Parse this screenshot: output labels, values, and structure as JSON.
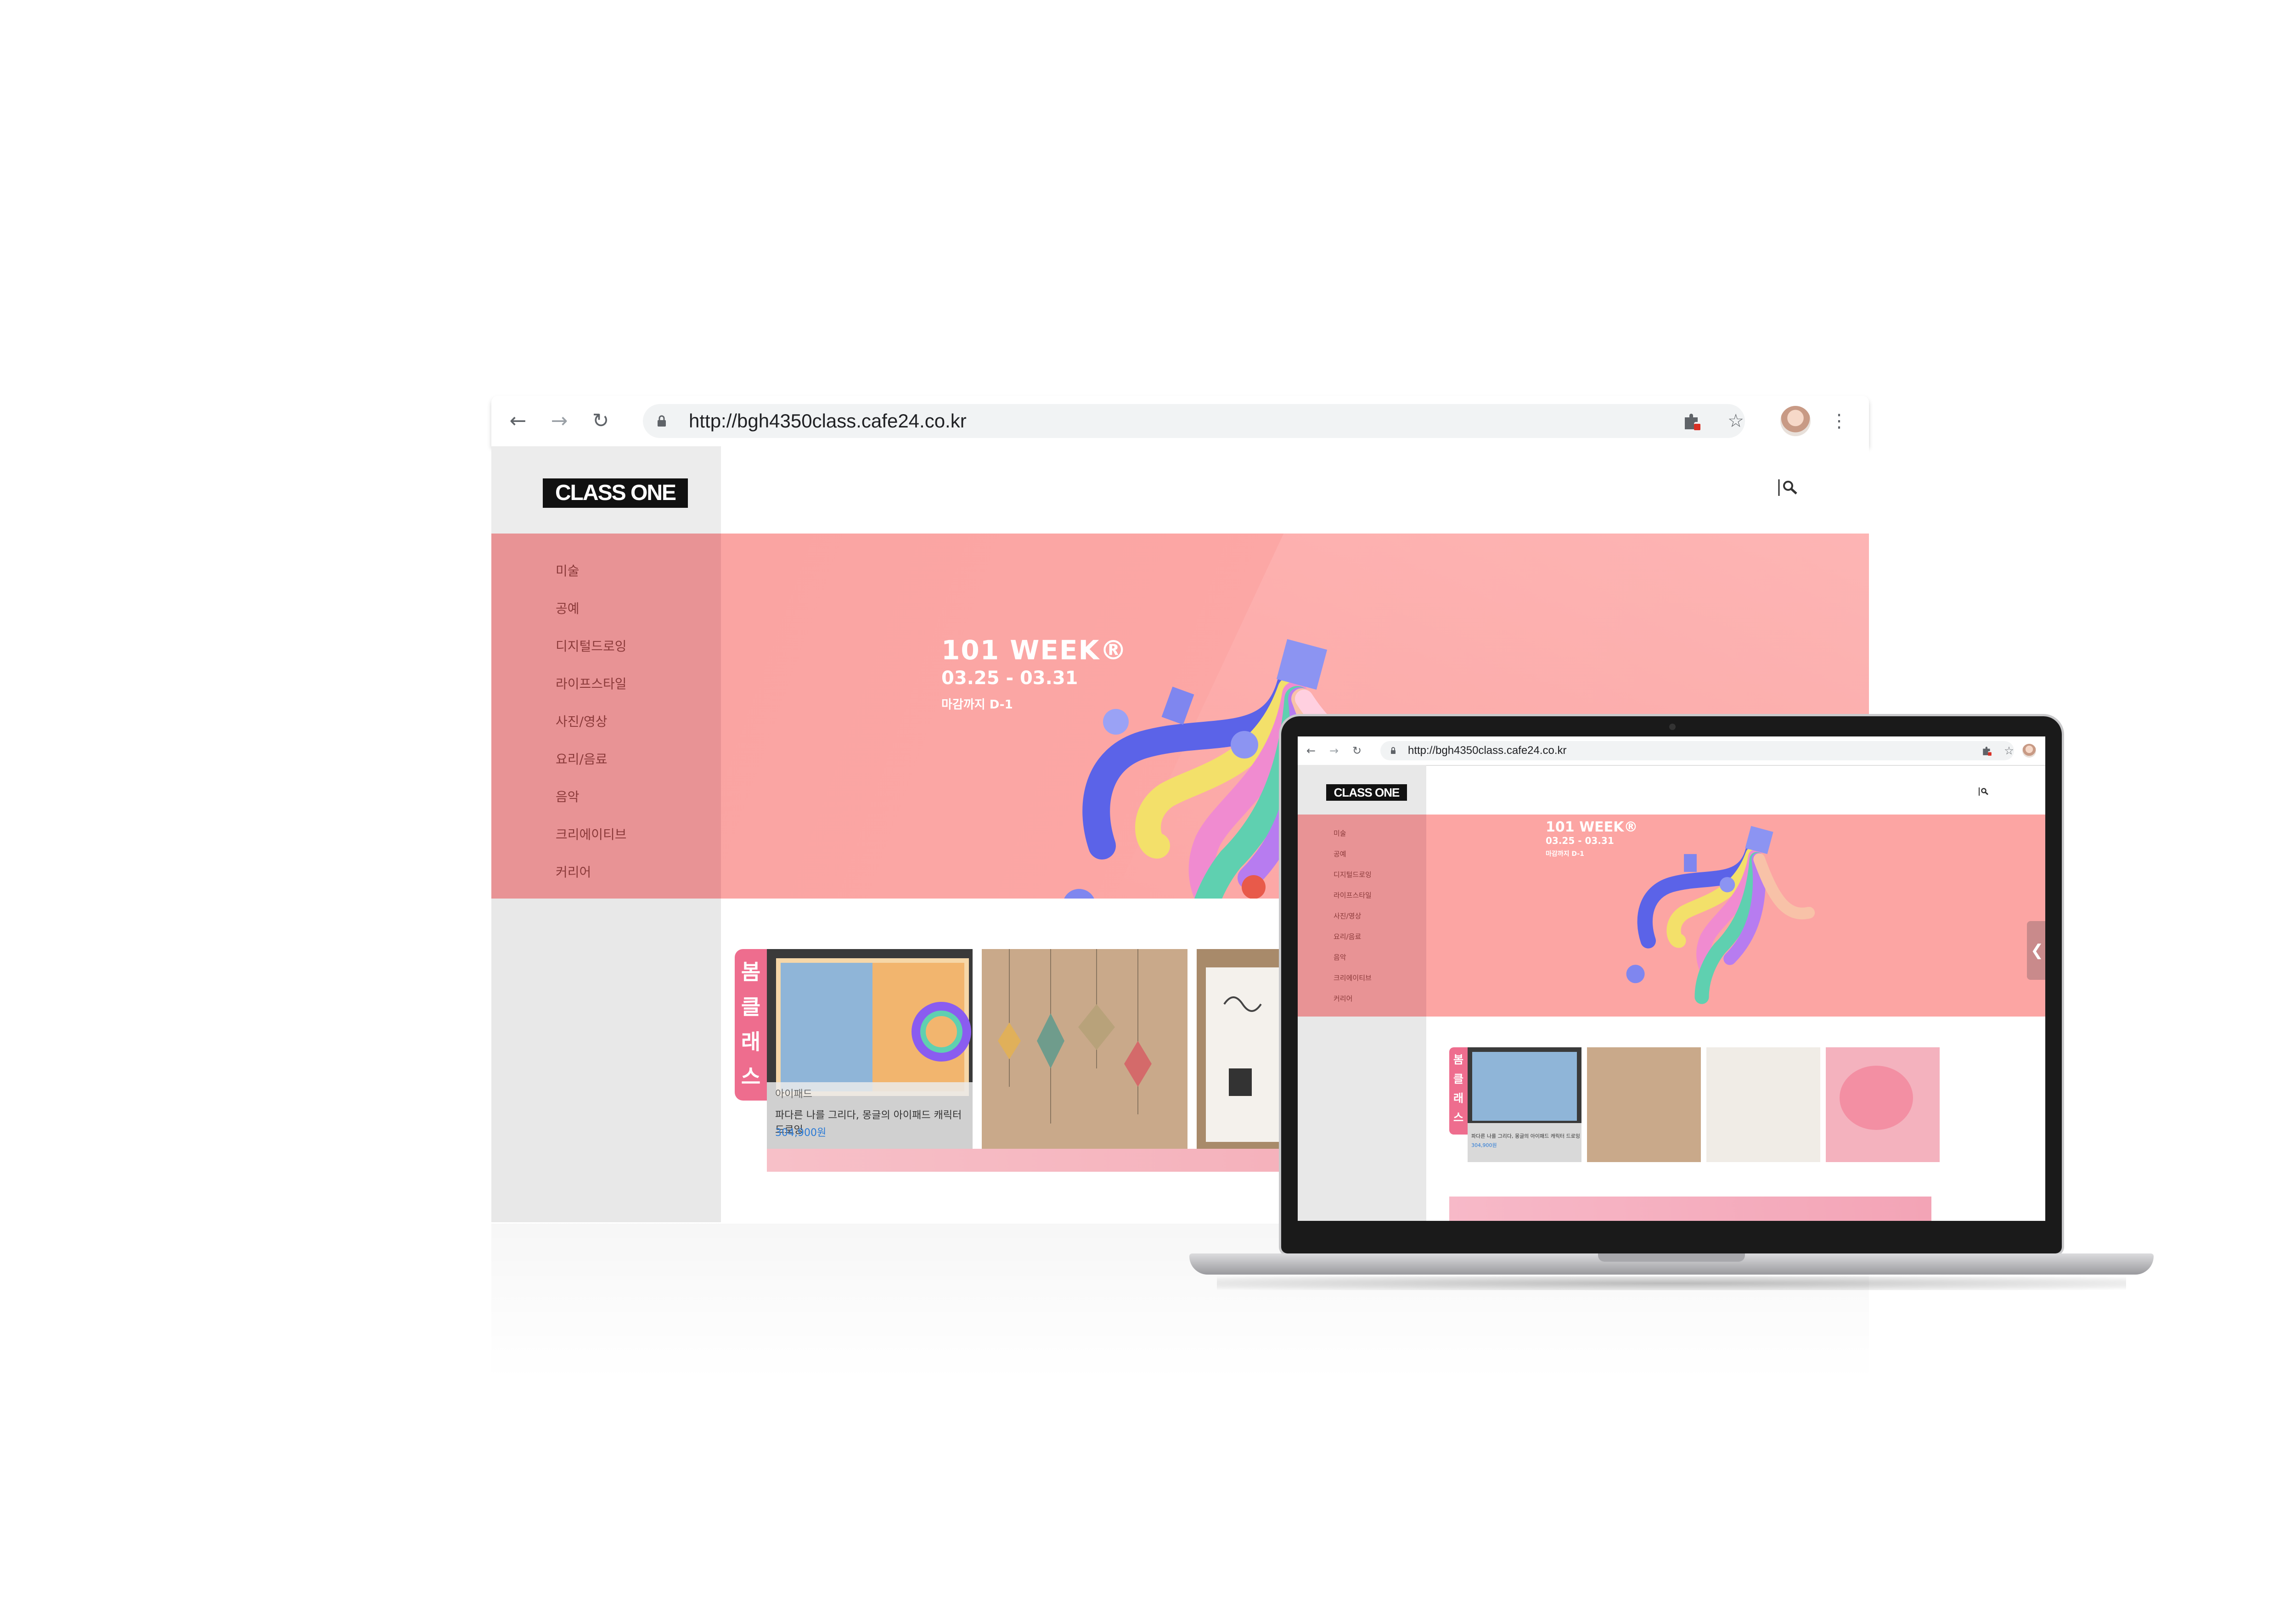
{
  "browser": {
    "url": "http://bgh4350class.cafe24.co.kr",
    "icons": {
      "back": "arrow-left-icon",
      "forward": "arrow-right-icon",
      "reload": "reload-icon",
      "lock": "lock-icon",
      "extension": "puzzle-icon",
      "bookmark": "star-icon",
      "profile": "avatar",
      "menu": "kebab-menu-icon"
    }
  },
  "site": {
    "logo": "CLASS ONE",
    "categories": [
      "미술",
      "공예",
      "디지털드로잉",
      "라이프스타일",
      "사진/영상",
      "요리/음료",
      "음악",
      "크리에이티브",
      "커리어"
    ],
    "hero": {
      "title": "101 WEEK®",
      "dates": "03.25 - 03.31",
      "deadline": "마감까지 D-1"
    },
    "products_badge": "봄클래스",
    "products": [
      {
        "category": "아이패드",
        "title": "파다른 나를 그리다, 몽글의 아이패드 캐릭터 드로잉",
        "price": "304,900원"
      }
    ],
    "colors": {
      "hero_bg": "#fca7a5",
      "category_panel": "#e89395",
      "badge": "#ee6d8e",
      "sidebar": "#e8e8e8",
      "price": "#2a7ad6"
    }
  },
  "laptop": {
    "url": "http://bgh4350class.cafe24.co.kr"
  }
}
